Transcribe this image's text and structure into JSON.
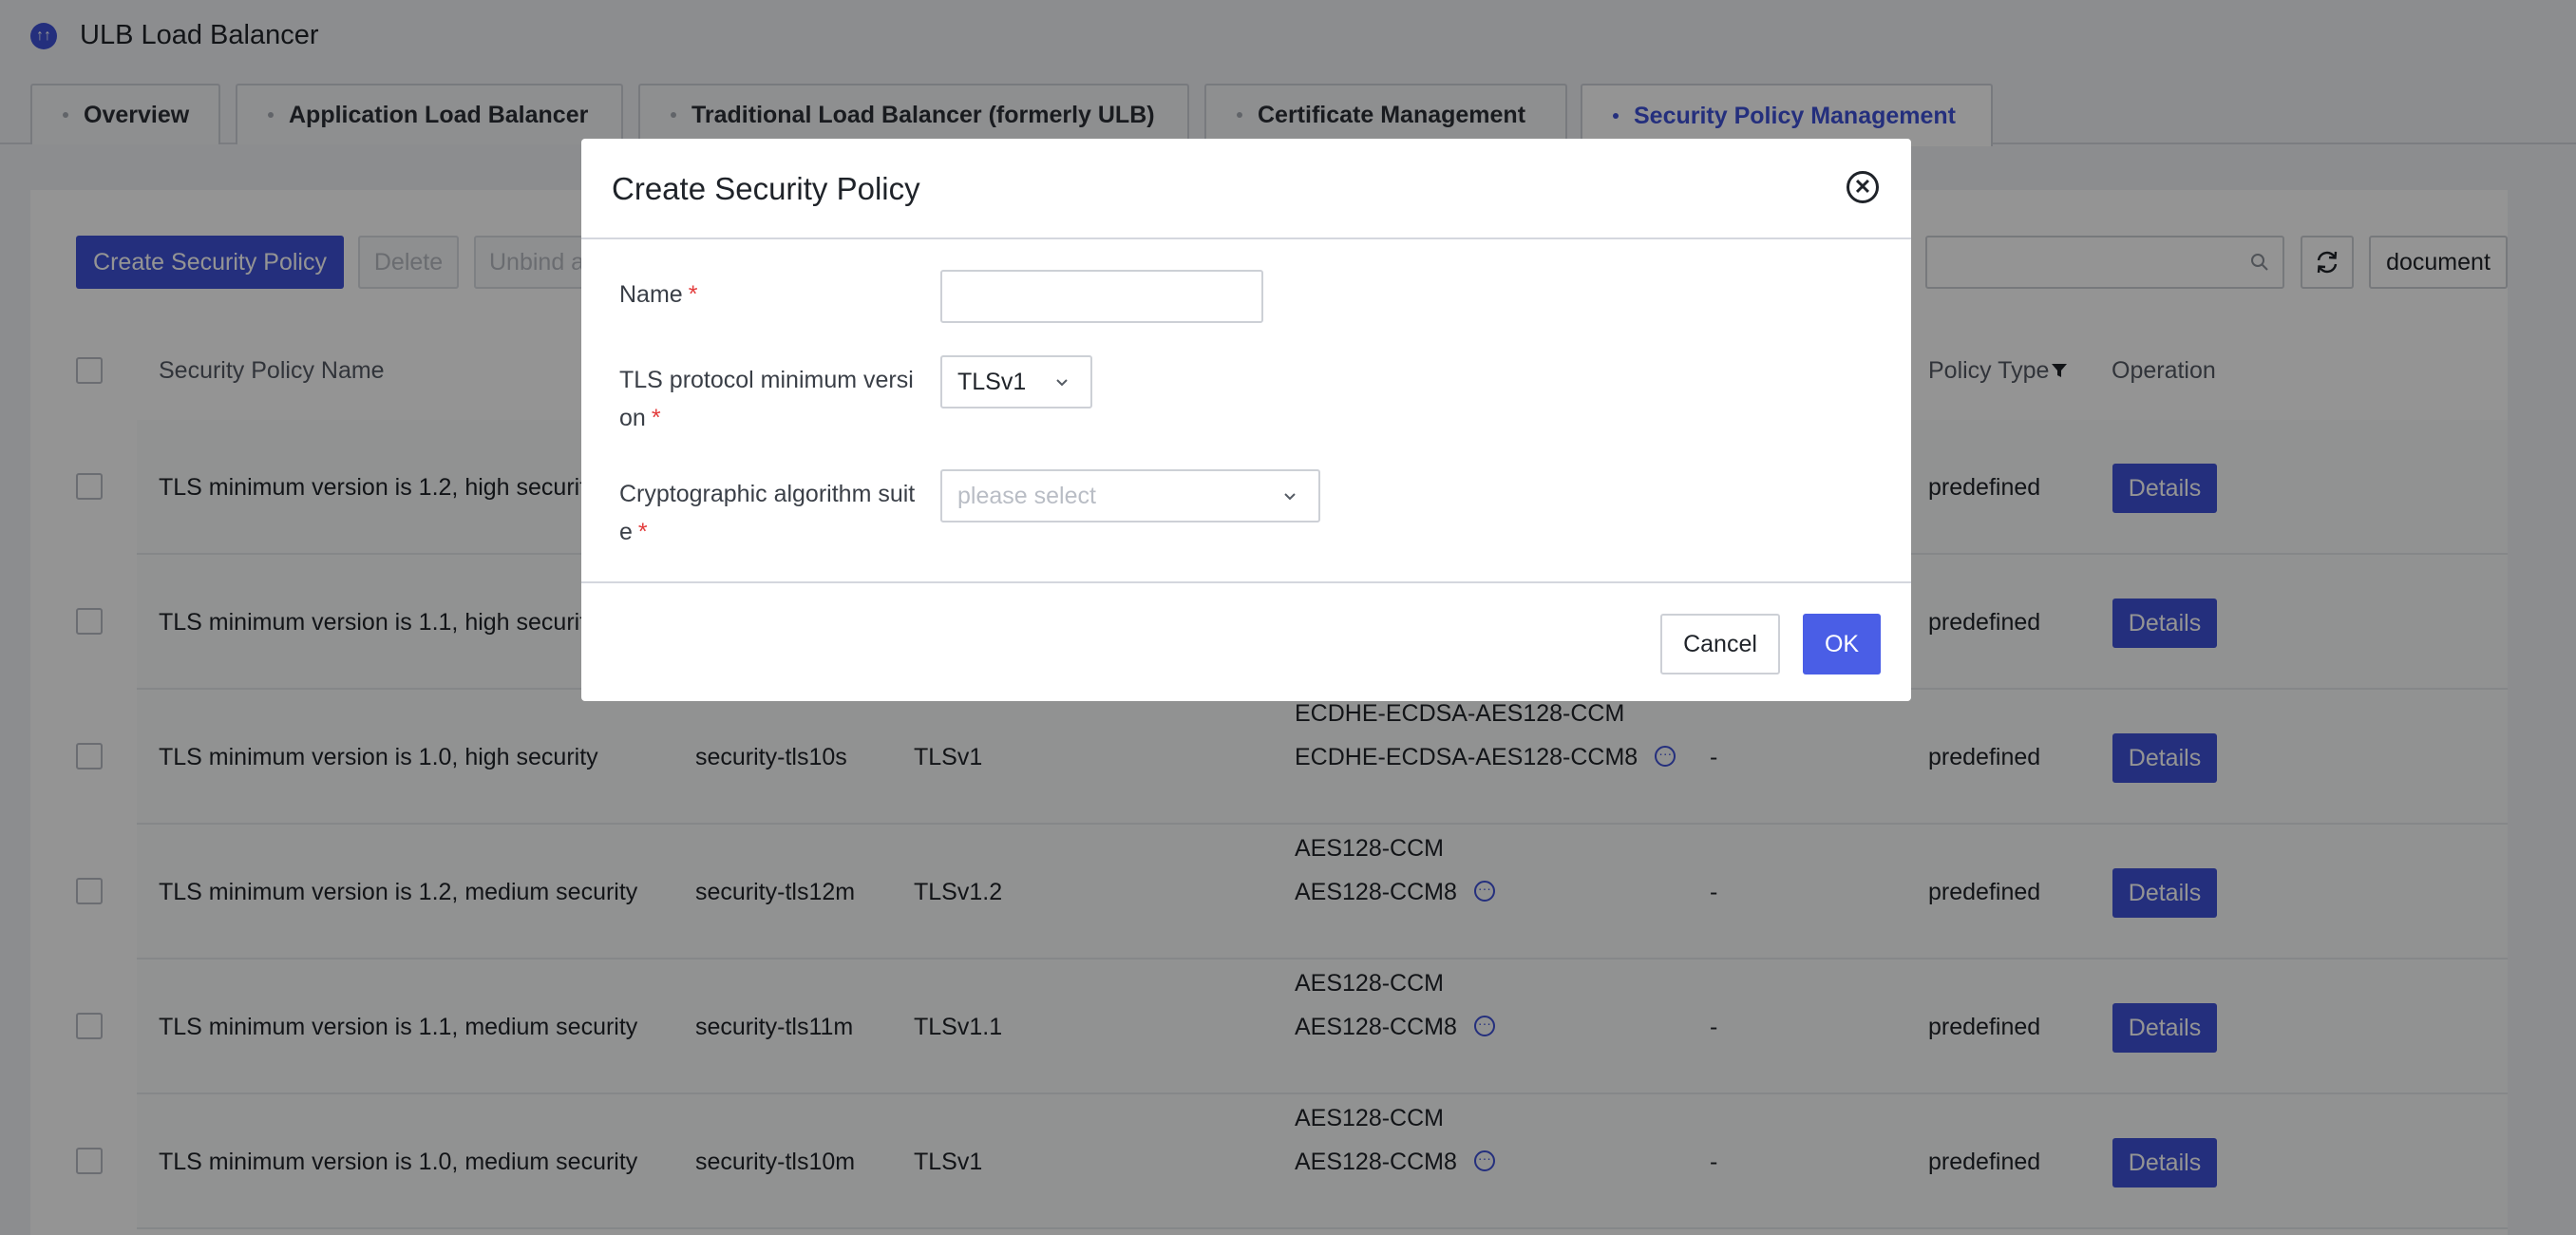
{
  "app": {
    "title": "ULB Load Balancer",
    "logo_glyph": "↑↑"
  },
  "tabs": [
    {
      "label": "Overview"
    },
    {
      "label": "Application Load Balancer"
    },
    {
      "label": "Traditional Load Balancer (formerly ULB)"
    },
    {
      "label": "Certificate Management"
    },
    {
      "label": "Security Policy Management",
      "active": true
    }
  ],
  "toolbar": {
    "create_label": "Create Security Policy",
    "delete_label": "Delete",
    "unbind_label": "Unbind a",
    "search_placeholder": "",
    "document_label": "document"
  },
  "table": {
    "headers": {
      "name": "Security Policy Name",
      "policy_type": "Policy Type",
      "operation": "Operation"
    },
    "rows": [
      {
        "name": "TLS minimum version is 1.2, high security",
        "id": "",
        "tls": "",
        "suites": [
          "",
          ""
        ],
        "extra": "",
        "type": "predefined",
        "action": "Details"
      },
      {
        "name": "TLS minimum version is 1.1, high security",
        "id": "",
        "tls": "",
        "suites": [
          "",
          ""
        ],
        "extra": "",
        "type": "predefined",
        "action": "Details"
      },
      {
        "name": "TLS minimum version is 1.0, high security",
        "id": "security-tls10s",
        "tls": "TLSv1",
        "suites": [
          "ECDHE-ECDSA-AES128-CCM",
          "ECDHE-ECDSA-AES128-CCM8"
        ],
        "extra": "-",
        "type": "predefined",
        "action": "Details"
      },
      {
        "name": "TLS minimum version is 1.2, medium security",
        "id": "security-tls12m",
        "tls": "TLSv1.2",
        "suites": [
          "AES128-CCM",
          "AES128-CCM8"
        ],
        "extra": "-",
        "type": "predefined",
        "action": "Details"
      },
      {
        "name": "TLS minimum version is 1.1, medium security",
        "id": "security-tls11m",
        "tls": "TLSv1.1",
        "suites": [
          "AES128-CCM",
          "AES128-CCM8"
        ],
        "extra": "-",
        "type": "predefined",
        "action": "Details"
      },
      {
        "name": "TLS minimum version is 1.0, medium security",
        "id": "security-tls10m",
        "tls": "TLSv1",
        "suites": [
          "AES128-CCM",
          "AES128-CCM8"
        ],
        "extra": "-",
        "type": "predefined",
        "action": "Details"
      }
    ]
  },
  "modal": {
    "title": "Create Security Policy",
    "name_label": "Name",
    "name_value": "",
    "tls_label_line1": "TLS protocol minimum versi",
    "tls_label_line2": "on",
    "tls_value": "TLSv1",
    "suite_label_line1": "Cryptographic algorithm suit",
    "suite_label_line2": "e",
    "suite_placeholder": "please select",
    "required_mark": "*",
    "cancel_label": "Cancel",
    "ok_label": "OK"
  },
  "colors": {
    "accent": "#3f51d7",
    "required": "#e33c3c",
    "mask": "rgba(0,0,0,0.42)"
  }
}
